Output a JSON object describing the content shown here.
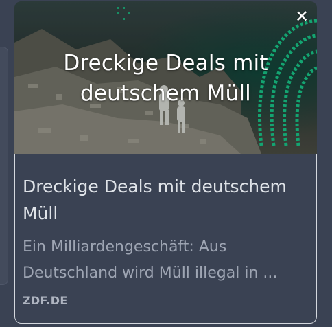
{
  "preview_card": {
    "close_symbol": "✕",
    "image_overlay_title": "Dreckige Deals mit deutschem Müll",
    "headline": "Dreckige Deals mit deutschem Müll",
    "description": "Ein Milliardengeschäft: Aus Deutschland wird Müll illegal in ...",
    "source": "ZDF.DE"
  },
  "icons": {
    "close": "close-icon"
  },
  "colors": {
    "page_background": "#3a4253",
    "card_border": "#d4d8de",
    "headline_text": "#dfe3e8",
    "description_text": "#9ea5b3",
    "accent_green": "#19c98a"
  }
}
